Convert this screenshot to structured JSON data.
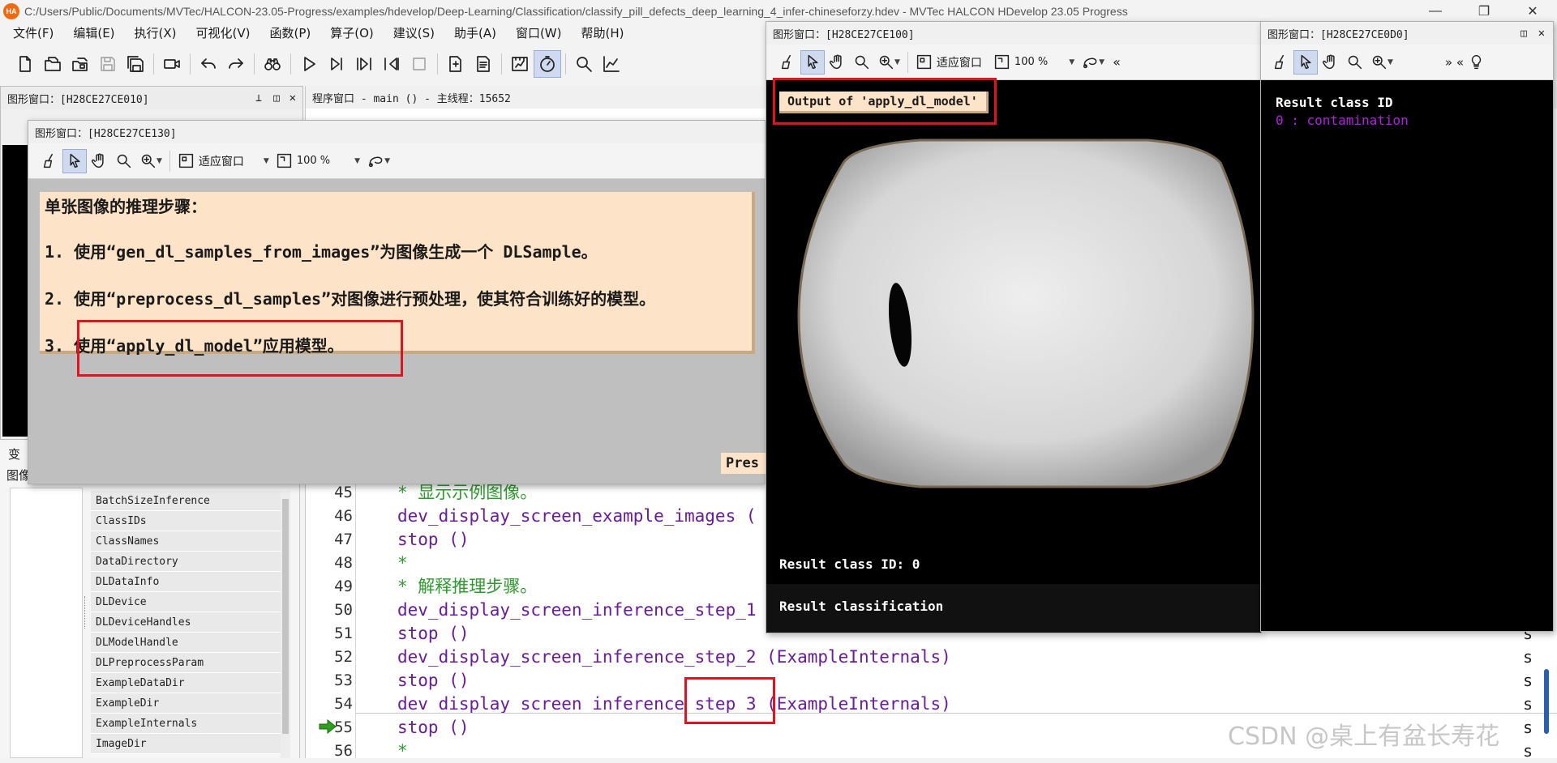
{
  "app": {
    "title": "C:/Users/Public/Documents/MVTec/HALCON-23.05-Progress/examples/hdevelop/Deep-Learning/Classification/classify_pill_defects_deep_learning_4_infer-chineseforzy.hdev - MVTec HALCON HDevelop 23.05 Progress",
    "logo": "HA",
    "win_minimize": "—",
    "win_maximize": "❐",
    "win_close": "✕"
  },
  "menu": [
    "文件(F)",
    "编辑(E)",
    "执行(X)",
    "可视化(V)",
    "函数(P)",
    "算子(O)",
    "建议(S)",
    "助手(A)",
    "窗口(W)",
    "帮助(H)"
  ],
  "toolbar_icons": [
    "new-file-icon",
    "open-file-icon",
    "open-example-icon",
    "save-disabled-icon",
    "save-all-icon",
    "camera-icon",
    "undo-icon",
    "redo-icon",
    "find-icon",
    "run-icon",
    "step-over-icon",
    "step-into-icon",
    "step-out-icon",
    "stop-icon",
    "insert-icon",
    "properties-icon",
    "profiler-icon",
    "timer-icon",
    "zoom-icon",
    "chart-icon"
  ],
  "graphics_window_010": {
    "title": "图形窗口：[H28CE27CE010]",
    "pin": "⊥",
    "float": "◫",
    "close": "✕"
  },
  "program_window": {
    "title": "程序窗口 - main () - 主线程：15652"
  },
  "graphics_window_130": {
    "title": "图形窗口：[H28CE27CE130]",
    "fit_label": "适应窗口",
    "zoom_label": "100 %",
    "heading": "单张图像的推理步骤：",
    "steps": [
      {
        "num": "1.",
        "text": "使用“gen_dl_samples_from_images”为图像生成一个 DLSample。"
      },
      {
        "num": "2.",
        "text": "使用“preprocess_dl_samples”对图像进行预处理，使其符合训练好的模型。"
      },
      {
        "num": "3.",
        "text": "使用“apply_dl_model”应用模型。"
      }
    ],
    "press_label": "Pres"
  },
  "graphics_window_100": {
    "title": "图形窗口：[H28CE27CE100]",
    "fit_label": "适应窗口",
    "zoom_label": "100 %",
    "overlay_label": "Output of 'apply_dl_model'",
    "result_id": "Result class ID: 0",
    "result_classification": "Result classification",
    "more": "«"
  },
  "graphics_window_0d0": {
    "title": "图形窗口：[H28CE27CE0D0]",
    "heading": "Result class ID",
    "entry": "0 : contamination",
    "more": "» «"
  },
  "variable_window": {
    "tab1": "变",
    "tab2": "图像",
    "variables": [
      "BatchSizeInference",
      "ClassIDs",
      "ClassNames",
      "DataDirectory",
      "DLDataInfo",
      "DLDevice",
      "DLDeviceHandles",
      "DLModelHandle",
      "DLPreprocessParam",
      "ExampleDataDir",
      "ExampleDir",
      "ExampleInternals",
      "ImageDir"
    ]
  },
  "code": [
    {
      "line": "45",
      "text": "* 显示示例图像。",
      "kind": "comment"
    },
    {
      "line": "46",
      "text": "dev_display_screen_example_images (",
      "kind": "proc"
    },
    {
      "line": "47",
      "text": "stop ()",
      "kind": "proc"
    },
    {
      "line": "48",
      "text": "*",
      "kind": "comment"
    },
    {
      "line": "49",
      "text": "* 解释推理步骤。",
      "kind": "comment"
    },
    {
      "line": "50",
      "text": "dev_display_screen_inference_step_1",
      "kind": "proc"
    },
    {
      "line": "51",
      "text": "stop ()",
      "kind": "proc"
    },
    {
      "line": "52",
      "text": "dev_display_screen_inference_step_2 (ExampleInternals)",
      "kind": "proc"
    },
    {
      "line": "53",
      "text": "stop ()",
      "kind": "proc"
    },
    {
      "line": "54",
      "text": "dev_display_screen_inference_step_3 (ExampleInternals)",
      "kind": "proc"
    },
    {
      "line": "55",
      "text": "stop ()",
      "kind": "proc"
    },
    {
      "line": "56",
      "text": "*",
      "kind": "comment"
    }
  ],
  "right_edge_fragments": [
    "s",
    "s",
    "s",
    "s",
    "s",
    "s"
  ],
  "watermark": "CSDN @桌上有盆长寿花"
}
